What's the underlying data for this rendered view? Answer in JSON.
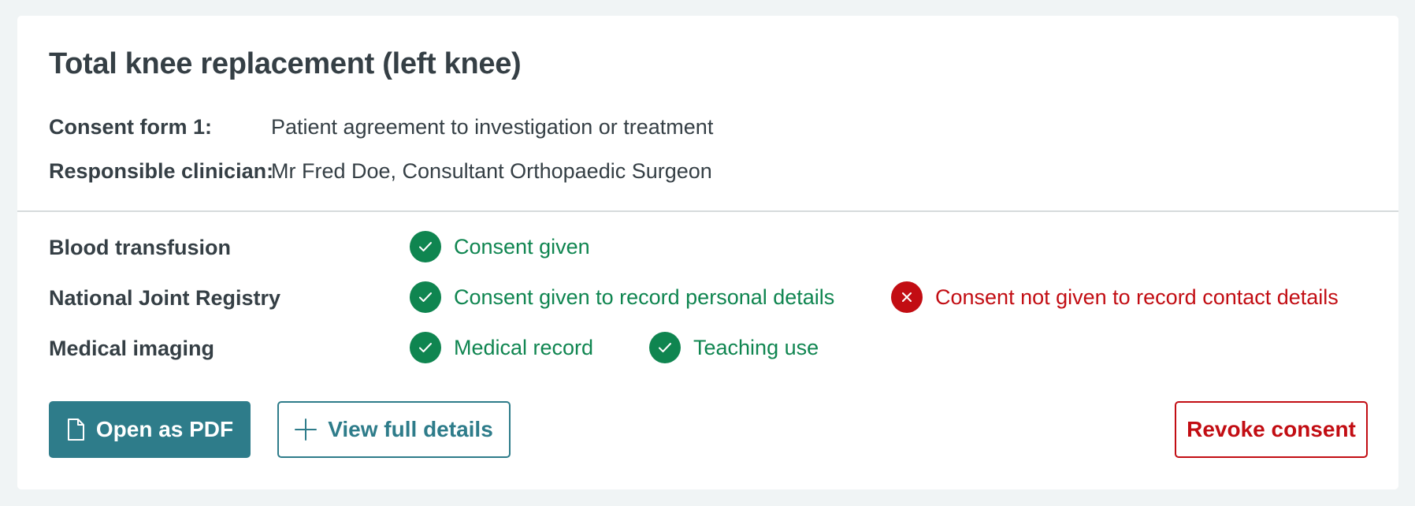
{
  "card": {
    "title": "Total knee replacement (left knee)",
    "meta": [
      {
        "label": "Consent form 1:",
        "value": "Patient agreement to investigation or treatment"
      },
      {
        "label": "Responsible clinician:",
        "value": "Mr Fred Doe, Consultant Orthopaedic Surgeon"
      }
    ],
    "rows": [
      {
        "label": "Blood transfusion",
        "statuses": [
          {
            "state": "given",
            "icon": "check-icon",
            "text": "Consent given"
          }
        ]
      },
      {
        "label": "National Joint Registry",
        "statuses": [
          {
            "state": "given",
            "icon": "check-icon",
            "text": "Consent given to record personal details"
          },
          {
            "state": "not_given",
            "icon": "cross-icon",
            "text": "Consent not given to record contact details"
          }
        ]
      },
      {
        "label": "Medical imaging",
        "statuses": [
          {
            "state": "given",
            "icon": "check-icon",
            "text": "Medical record"
          },
          {
            "state": "given",
            "icon": "check-icon",
            "text": "Teaching use"
          }
        ]
      }
    ],
    "actions": {
      "open_pdf": {
        "label": "Open as PDF",
        "icon": "document-icon"
      },
      "view_details": {
        "label": "View full details",
        "icon": "plus-icon"
      },
      "revoke": {
        "label": "Revoke consent"
      }
    }
  },
  "colors": {
    "primary": "#2e7c8a",
    "success": "#0f8550",
    "danger": "#c20d13",
    "text": "#353f45",
    "page_background": "#f0f4f5"
  }
}
